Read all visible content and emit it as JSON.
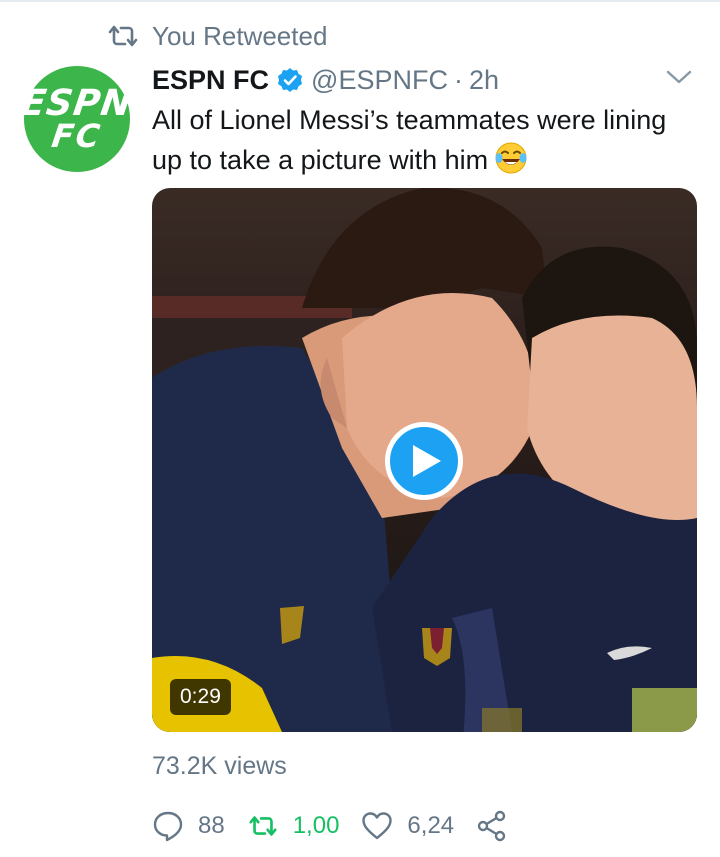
{
  "retweet_context": {
    "text": "You Retweeted",
    "icon": "retweet-icon"
  },
  "author": {
    "display_name": "ESPN FC",
    "handle": "@ESPNFC",
    "separator": "·",
    "time": "2h",
    "verified": true,
    "avatar_logo_top": "ESPN",
    "avatar_logo_bottom": "FC",
    "avatar_color": "#3cb54a"
  },
  "tweet": {
    "text": "All of Lionel Messi’s teammates were lining up to take a picture with him",
    "emoji": "face-with-tears-of-joy"
  },
  "media": {
    "type": "video",
    "duration": "0:29",
    "play_button_color": "#1da1f2"
  },
  "views": "73.2K views",
  "actions": {
    "reply_count": "88",
    "retweet_count": "1,00",
    "like_count": "6,24",
    "retweet_active_color": "#17bf63"
  },
  "colors": {
    "secondary_text": "#657786",
    "accent": "#1da1f2"
  }
}
